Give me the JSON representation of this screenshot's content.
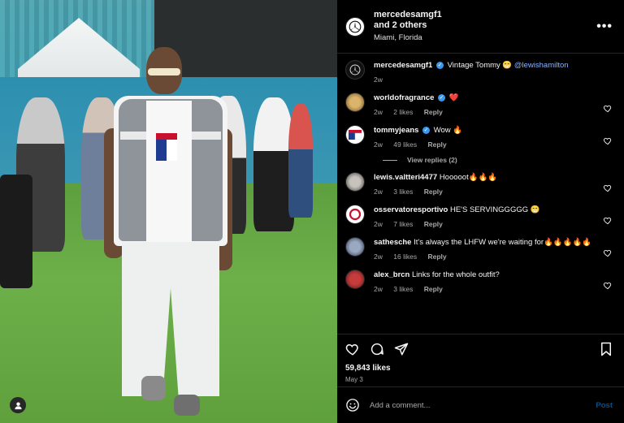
{
  "header": {
    "username": "mercedesamgf1",
    "coauthors": "and 2 others",
    "location": "Miami, Florida",
    "more_icon": "more-horizontal-icon"
  },
  "caption": {
    "username": "mercedesamgf1",
    "text": "Vintage Tommy 😁",
    "mention": "@lewishamilton",
    "time": "2w"
  },
  "comments": [
    {
      "username": "worldofragrance",
      "verified": true,
      "text": "❤️",
      "time": "2w",
      "likes": "2 likes",
      "reply": "Reply"
    },
    {
      "username": "tommyjeans",
      "verified": true,
      "text": "Wow 🔥",
      "time": "2w",
      "likes": "49 likes",
      "reply": "Reply"
    },
    {
      "username": "lewis.valtteri4477",
      "verified": false,
      "text": "Hooooot🔥🔥🔥",
      "time": "2w",
      "likes": "3 likes",
      "reply": "Reply"
    },
    {
      "username": "osservatoresportivo",
      "verified": false,
      "text": "HE'S SERVINGGGGG 😁",
      "time": "2w",
      "likes": "7 likes",
      "reply": "Reply"
    },
    {
      "username": "sathesche",
      "verified": false,
      "text": "It's always the LHFW we're waiting for🔥🔥🔥🔥🔥",
      "time": "2w",
      "likes": "16 likes",
      "reply": "Reply"
    },
    {
      "username": "alex_brcn",
      "verified": false,
      "text": "Links for the whole outfit?",
      "time": "2w",
      "likes": "3 likes",
      "reply": "Reply"
    }
  ],
  "view_replies": "View replies (2)",
  "engagement": {
    "likes": "59,843 likes",
    "date": "May 3"
  },
  "composer": {
    "placeholder": "Add a comment...",
    "post_label": "Post"
  },
  "colors": {
    "background": "#000000",
    "verified": "#3897f0",
    "mention": "#8ab4ff",
    "post_button": "#0a4f86"
  }
}
